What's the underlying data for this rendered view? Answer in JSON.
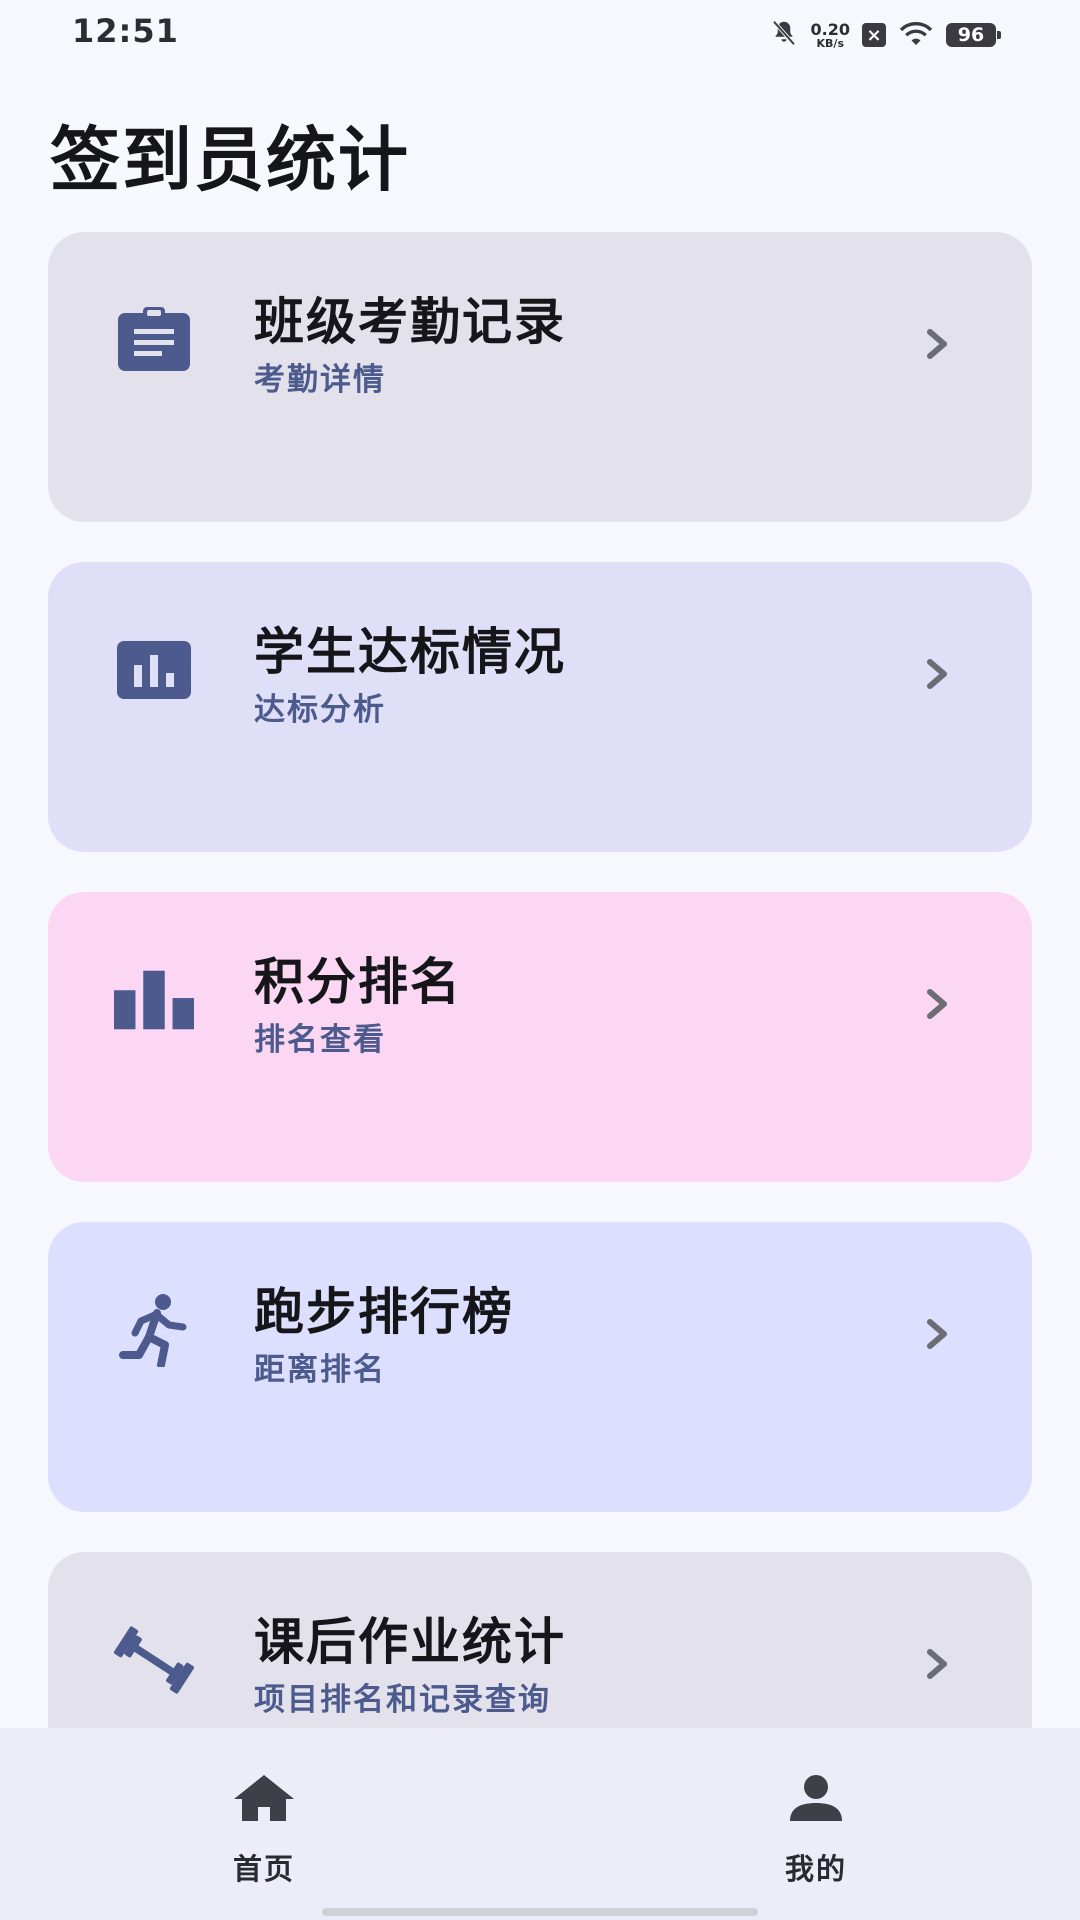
{
  "status_bar": {
    "time": "12:51",
    "net_speed_value": "0.20",
    "net_speed_unit": "KB/s",
    "battery": "96",
    "icons": [
      "mute-bell-icon",
      "notification-x-icon",
      "wifi-icon",
      "battery-icon"
    ]
  },
  "page_title": "签到员统计",
  "cards": [
    {
      "title": "班级考勤记录",
      "subtitle": "考勤详情",
      "icon": "clipboard-icon",
      "bg": "#e3e2ec"
    },
    {
      "title": "学生达标情况",
      "subtitle": "达标分析",
      "icon": "bar-chart-box-icon",
      "bg": "#dfe0f8"
    },
    {
      "title": "积分排名",
      "subtitle": "排名查看",
      "icon": "bar-chart-icon",
      "bg": "#fcd7f3"
    },
    {
      "title": "跑步排行榜",
      "subtitle": "距离排名",
      "icon": "runner-icon",
      "bg": "#dce0fe"
    },
    {
      "title": "课后作业统计",
      "subtitle": "项目排名和记录查询",
      "icon": "dumbbell-icon",
      "bg": "#e3e2ec"
    }
  ],
  "colors": {
    "accent": "#4c5a8e",
    "background": "#f7f8fd",
    "nav_background": "#ecedf8"
  },
  "bottom_nav": [
    {
      "label": "首页",
      "icon": "home-icon"
    },
    {
      "label": "我的",
      "icon": "person-icon"
    }
  ]
}
